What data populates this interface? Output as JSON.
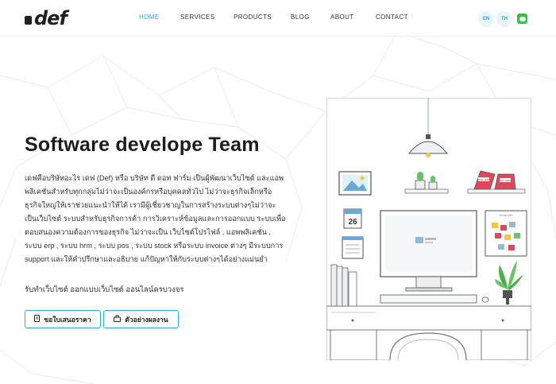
{
  "nav": {
    "logo": "def",
    "items": [
      {
        "label": "HOME",
        "active": true
      },
      {
        "label": "SERVICES",
        "active": false
      },
      {
        "label": "PRODUCTS",
        "active": false
      },
      {
        "label": "BLOG",
        "active": false
      },
      {
        "label": "ABOUT",
        "active": false
      },
      {
        "label": "CONTACT",
        "active": false
      }
    ],
    "lang_en": "EN",
    "lang_th": "TH",
    "line_icon": "line-chat-icon"
  },
  "hero": {
    "title": "Software develope Team",
    "description": "เดฟคือบริษัทอะไร เดฟ (Def) หรือ บริษัท ดี ดอท ฟาร์ม เป็นผู้พัฒนาเว็บไซต์ และแอพพลิเคชั่นสำหรับทุกกลุ่มไม่ว่าจะเป็นองค์กรหรือบุคคลทั่วไป ไม่ว่าจะธุรกิจเล็กหรือธุรกิจใหญ่ให้เราช่วยแนะนำให้ได้ เรามีผู้เชี่ยวชาญในการสร้างระบบต่างๆไม่ว่าจะเป็นเว็บไซต์ ระบบสำหรับธุรกิจการค้า การวิเคราะห์ข้อมูลและการออกแบบ ระบบเพื่อตอบสนองความต้องการของธุรกิจ ไม่ว่าจะเป็น เว็บไซต์โปรไฟล์ , แอพพลิเคชั่น , ระบบ erp , ระบบ hrm , ระบบ pos , ระบบ stock หรือระบบ invoice ต่างๆ มีระบบการ support และให้คำปรึกษาและอธิบาย แก้ปัญหาให้กับระบบต่างๆได้อย่างแม่นยำ",
    "tagline": "รับทำเว็บไซต์ ออกแบบเว็บไซต์ ออนไลน์ครบวงจร",
    "quote_button": "ขอใบเสนอราคา",
    "portfolio_button": "ตัวอย่างผลงาน"
  },
  "illustration": {
    "calendar_day": "26",
    "sign_left": "WORK HARD",
    "sign_right": "PLAY HARD",
    "board_title": "TO DO LIST"
  },
  "colors": {
    "accent": "#2fa6e4",
    "line_green": "#29c93e",
    "text": "#1c1c1c"
  }
}
